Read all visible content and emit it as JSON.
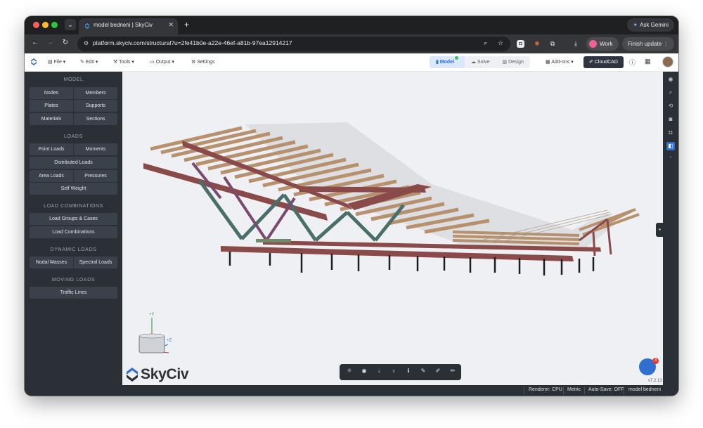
{
  "browser": {
    "tab_title": "model bedneni | SkyCiv",
    "url": "platform.skyciv.com/structural?u=2fe41b0e-a22e-46ef-a81b-97ea12914217",
    "gemini_label": "Ask Gemini",
    "profile_label": "Work",
    "update_label": "Finish update"
  },
  "toolbar": {
    "file": "File",
    "edit": "Edit",
    "tools": "Tools",
    "output": "Output",
    "settings": "Settings",
    "mode_model": "Model",
    "mode_solve": "Solve",
    "mode_design": "Design",
    "addons": "Add-ons",
    "cloudcad": "CloudCAD"
  },
  "sidebar": {
    "model_title": "MODEL",
    "nodes": "Nodes",
    "members": "Members",
    "plates": "Plates",
    "supports": "Supports",
    "materials": "Materials",
    "sections": "Sections",
    "loads_title": "LOADS",
    "point_loads": "Point Loads",
    "moments": "Moments",
    "distributed_loads": "Distributed Loads",
    "area_loads": "Area Loads",
    "pressures": "Pressures",
    "self_weight": "Self Weight",
    "combos_title": "LOAD COMBINATIONS",
    "load_groups": "Load Groups & Cases",
    "load_combinations": "Load Combinations",
    "dynamic_title": "DYNAMIC LOADS",
    "nodal_masses": "Nodal Masses",
    "spectral_loads": "Spectral Loads",
    "moving_title": "MOVING LOADS",
    "traffic_lines": "Traffic Lines"
  },
  "viewport": {
    "axis_y": "+Y",
    "axis_z": "+Z",
    "brand": "SkyCiv",
    "chat_count": "3",
    "version": "v7.2.13"
  },
  "status": {
    "renderer": "Renderer: CPU",
    "units": "Metric",
    "autosave": "Auto-Save: OFF",
    "model_name": "model bedneni"
  },
  "colors": {
    "accent": "#2f6fd1",
    "steel_beam": "#8b4a4a",
    "bracing": "#4a6e6a",
    "timber": "#b7916d"
  }
}
